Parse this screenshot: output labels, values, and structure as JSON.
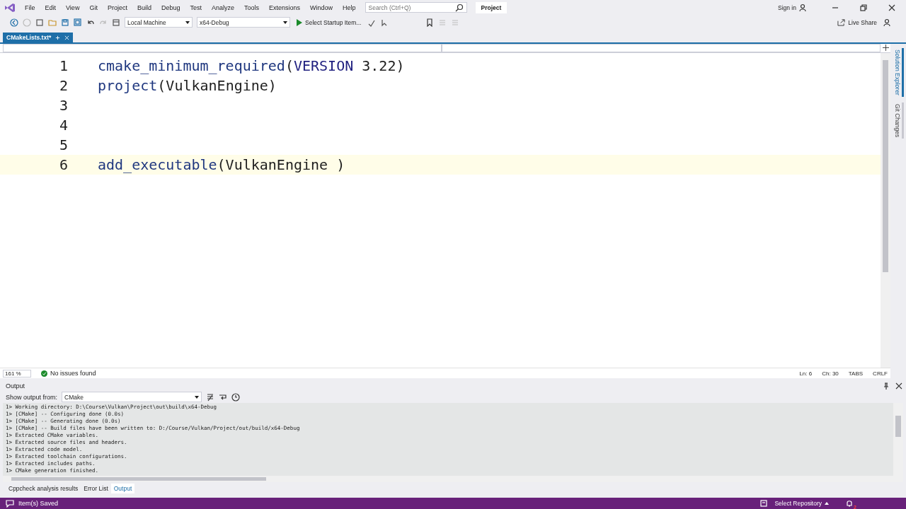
{
  "menu": [
    "File",
    "Edit",
    "View",
    "Git",
    "Project",
    "Build",
    "Debug",
    "Test",
    "Analyze",
    "Tools",
    "Extensions",
    "Window",
    "Help"
  ],
  "search": {
    "placeholder": "Search (Ctrl+Q)"
  },
  "solution_name": "Project",
  "sign_in": "Sign in",
  "toolbar": {
    "target": "Local Machine",
    "config": "x64-Debug",
    "startup": "Select Startup Item...",
    "live_share": "Live Share"
  },
  "doc_tabs": [
    {
      "label": "CMakeLists.txt*",
      "selected": true
    }
  ],
  "editor": {
    "lines": [
      {
        "number": "1",
        "current": false,
        "tokens": [
          {
            "kind": "command",
            "text": "cmake_minimum_required"
          },
          {
            "kind": "text",
            "text": "("
          },
          {
            "kind": "keyword",
            "text": "VERSION"
          },
          {
            "kind": "text",
            "text": " 3.22)"
          }
        ]
      },
      {
        "number": "2",
        "current": false,
        "tokens": [
          {
            "kind": "command",
            "text": "project"
          },
          {
            "kind": "text",
            "text": "(VulkanEngine)"
          }
        ]
      },
      {
        "number": "3",
        "current": false
      },
      {
        "number": "4",
        "current": false
      },
      {
        "number": "5",
        "current": false
      },
      {
        "number": "6",
        "current": true,
        "tokens": [
          {
            "kind": "command",
            "text": "add_executable"
          },
          {
            "kind": "text",
            "text": "(VulkanEngine )"
          }
        ]
      }
    ],
    "zoom": "161 %",
    "issues": "No issues found",
    "position": [
      "Ln: 6",
      "Ch: 30",
      "TABS",
      "CRLF"
    ]
  },
  "side_tabs": [
    {
      "label": "Solution Explorer",
      "selected": true
    },
    {
      "label": "Git Changes",
      "selected": false
    }
  ],
  "output": {
    "title": "Output",
    "show_from_label": "Show output from:",
    "source": "CMake",
    "lines": [
      "1> Working directory: D:\\Course\\Vulkan\\Project\\out\\build\\x64-Debug",
      "1> [CMake] -- Configuring done (0.0s)",
      "1> [CMake] -- Generating done (0.0s)",
      "1> [CMake] -- Build files have been written to: D:/Course/Vulkan/Project/out/build/x64-Debug",
      "1> Extracted CMake variables.",
      "1> Extracted source files and headers.",
      "1> Extracted code model.",
      "1> Extracted toolchain configurations.",
      "1> Extracted includes paths.",
      "1> CMake generation finished."
    ]
  },
  "bottom_tabs": [
    {
      "label": "Cppcheck analysis results",
      "selected": false
    },
    {
      "label": "Error List",
      "selected": false
    },
    {
      "label": "Output",
      "selected": true
    }
  ],
  "status_bar": {
    "message": "Item(s) Saved",
    "repository": "Select Repository",
    "notifications": "2"
  }
}
